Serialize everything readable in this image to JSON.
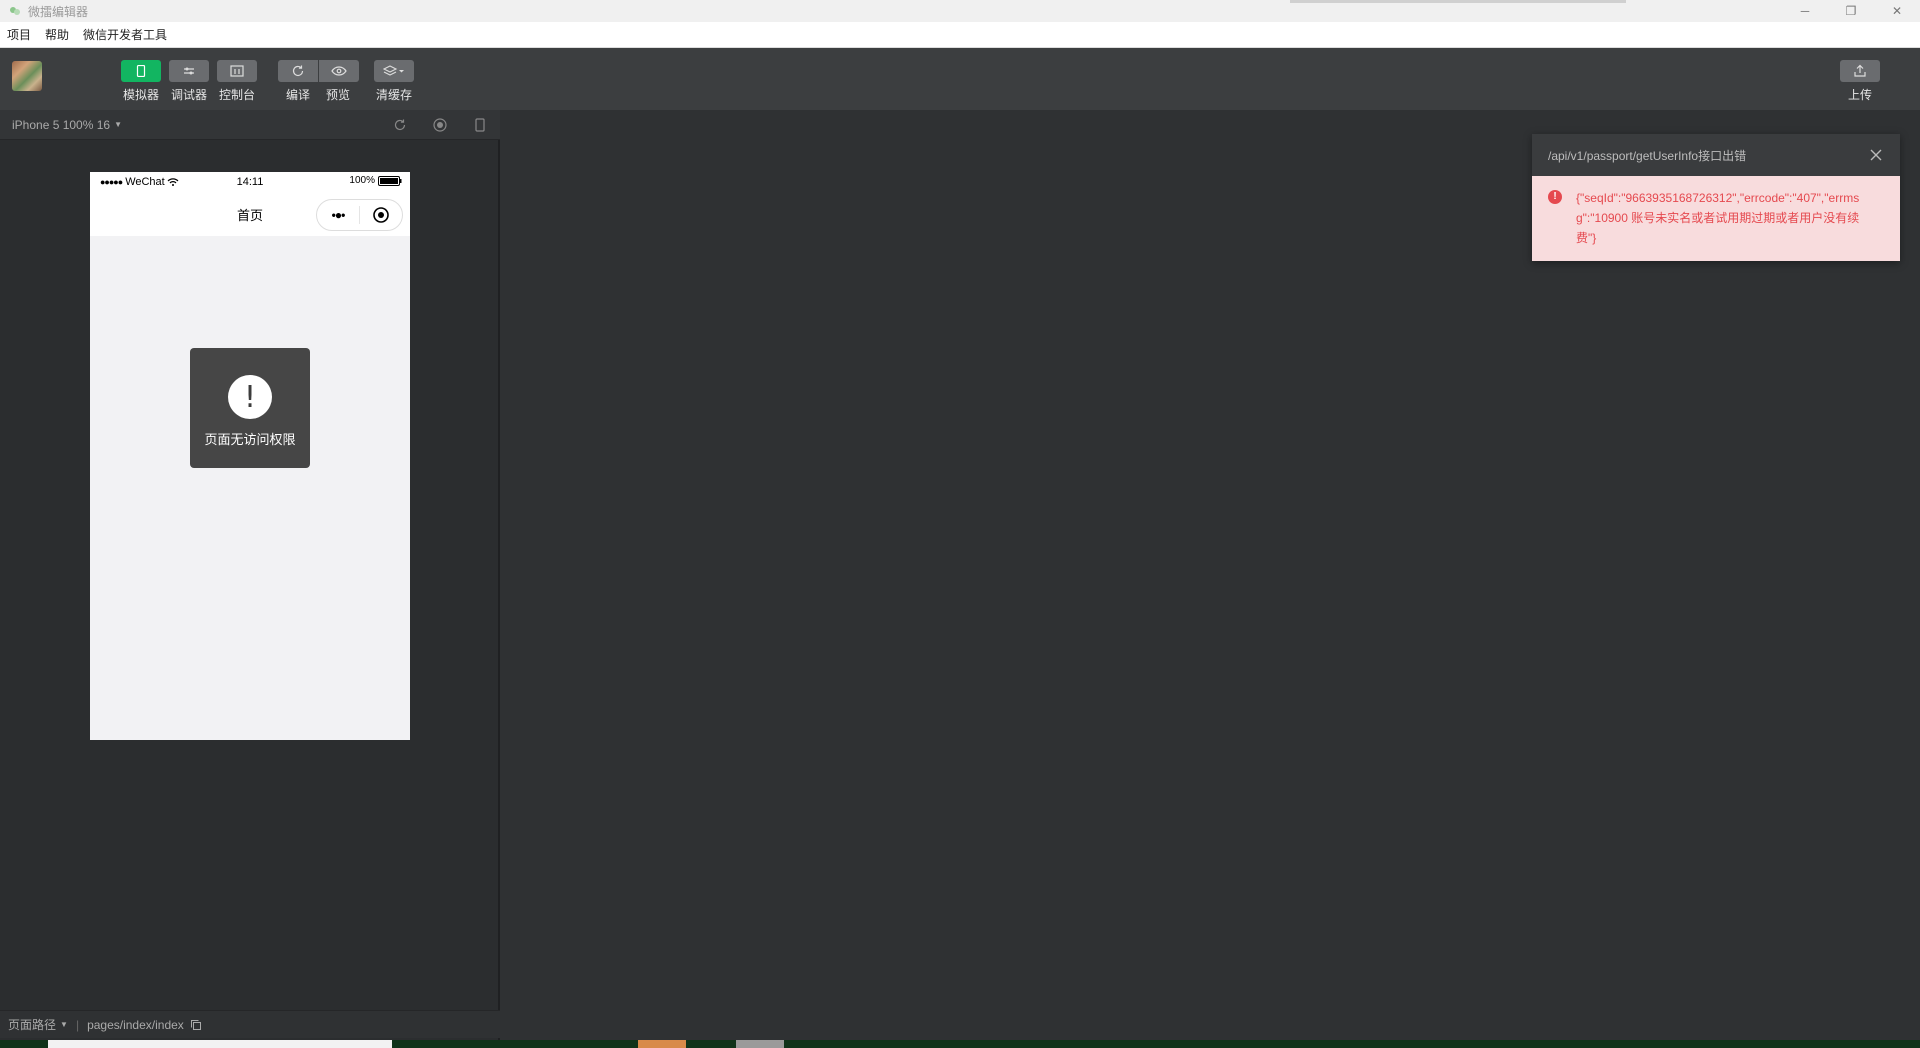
{
  "window": {
    "title": "微擂编辑器",
    "minimize_glyph": "─",
    "restore_glyph": "❐",
    "close_glyph": "✕"
  },
  "menu": [
    "项目",
    "帮助",
    "微信开发者工具"
  ],
  "toolbar": {
    "simulator_label": "模拟器",
    "debugger_label": "调试器",
    "console_label": "控制台",
    "compile_label": "编译",
    "preview_label": "预览",
    "clear_cache_label": "清缓存",
    "upload_label": "上传",
    "accent_color": "#12b561"
  },
  "simulator": {
    "device": "iPhone 5 100% 16",
    "status": {
      "signal": "●●●●●",
      "carrier": "WeChat",
      "time": "14:11",
      "battery": "100%"
    },
    "nav_title": "首页",
    "capsule_more": "•●•",
    "toast": {
      "icon": "!",
      "message": "页面无访问权限"
    }
  },
  "bottom_bar": {
    "path_label": "页面路径",
    "path_value": "pages/index/index"
  },
  "notification": {
    "title": "/api/v1/passport/getUserInfo接口出错",
    "message": "{\"seqId\":\"9663935168726312\",\"errcode\":\"407\",\"errmsg\":\"10900 账号未实名或者试用期过期或者用户没有续费\"}",
    "error_color": "#e5494f"
  }
}
